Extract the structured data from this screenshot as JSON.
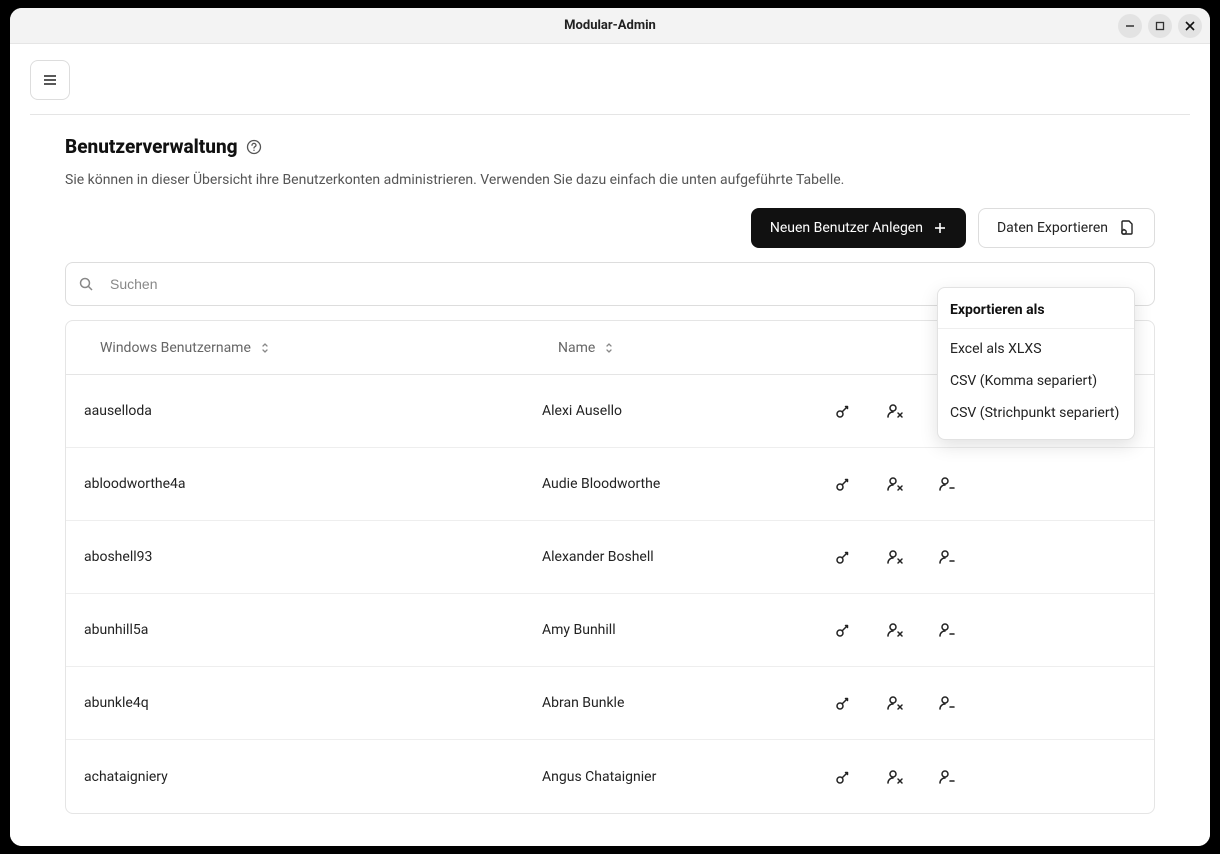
{
  "window": {
    "title": "Modular-Admin"
  },
  "page": {
    "title": "Benutzerverwaltung",
    "subtitle": "Sie können in dieser Übersicht ihre Benutzerkonten administrieren. Verwenden Sie dazu einfach die unten aufgeführte Tabelle."
  },
  "actions": {
    "new_user_label": "Neuen Benutzer Anlegen",
    "export_label": "Daten Exportieren"
  },
  "search": {
    "placeholder": "Suchen",
    "value": ""
  },
  "export_menu": {
    "header": "Exportieren als",
    "items": [
      "Excel als XLXS",
      "CSV (Komma separiert)",
      "CSV (Strichpunkt separiert)"
    ]
  },
  "table": {
    "columns": {
      "username": "Windows Benutzername",
      "name": "Name"
    },
    "rows": [
      {
        "username": "aauselloda",
        "name": "Alexi Ausello"
      },
      {
        "username": "abloodworthe4a",
        "name": "Audie Bloodworthe"
      },
      {
        "username": "aboshell93",
        "name": "Alexander Boshell"
      },
      {
        "username": "abunhill5a",
        "name": "Amy Bunhill"
      },
      {
        "username": "abunkle4q",
        "name": "Abran Bunkle"
      },
      {
        "username": "achataigniery",
        "name": "Angus Chataignier"
      }
    ]
  }
}
